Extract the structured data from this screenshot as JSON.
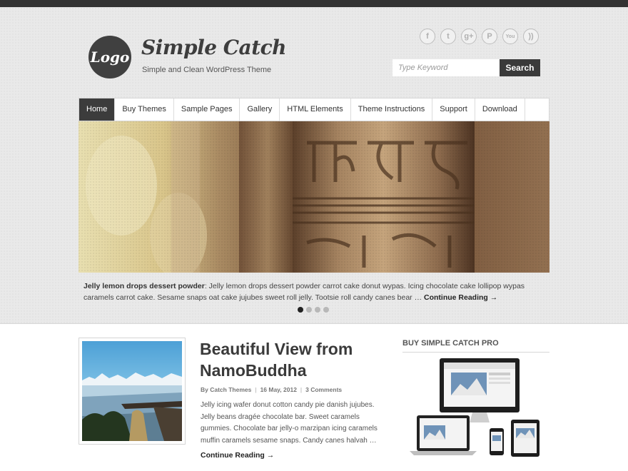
{
  "header": {
    "logo_text": "Logo",
    "site_title": "Simple Catch",
    "site_description": "Simple and Clean WordPress Theme",
    "social": [
      {
        "icon": "facebook-icon",
        "glyph": "f"
      },
      {
        "icon": "twitter-icon",
        "glyph": "t"
      },
      {
        "icon": "googleplus-icon",
        "glyph": "g+"
      },
      {
        "icon": "pinterest-icon",
        "glyph": "P"
      },
      {
        "icon": "youtube-icon",
        "glyph": "You"
      },
      {
        "icon": "rss-icon",
        "glyph": "))"
      }
    ],
    "search": {
      "placeholder": "Type Keyword",
      "button_label": "Search"
    }
  },
  "nav": {
    "items": [
      "Home",
      "Buy Themes",
      "Sample Pages",
      "Gallery",
      "HTML Elements",
      "Theme Instructions",
      "Support",
      "Download"
    ],
    "active": "Home"
  },
  "slider": {
    "caption_title": "Jelly lemon drops dessert powder",
    "caption_text": ": Jelly lemon drops dessert powder carrot cake donut wypas. Icing chocolate cake lollipop wypas caramels carrot cake. Sesame snaps oat cake jujubes sweet roll jelly. Tootsie roll candy canes bear … ",
    "continue_label": "Continue Reading →",
    "dots": 4,
    "active_dot": 0
  },
  "post": {
    "title": "Beautiful View from NamoBuddha",
    "author": "By Catch Themes",
    "date": "16 May, 2012",
    "comments": "3 Comments",
    "excerpt": "Jelly icing wafer donut cotton candy pie danish jujubes. Jelly beans dragée chocolate bar. Sweet caramels gummies. Chocolate bar jelly-o marzipan icing caramels muffin caramels sesame snaps. Candy canes halvah …",
    "continue_label": "Continue Reading →"
  },
  "sidebar": {
    "widget_title": "BUY SIMPLE CATCH PRO"
  },
  "colors": {
    "header_bg": "#e9e9e9",
    "dark": "#3c3c3c",
    "text": "#444444"
  }
}
